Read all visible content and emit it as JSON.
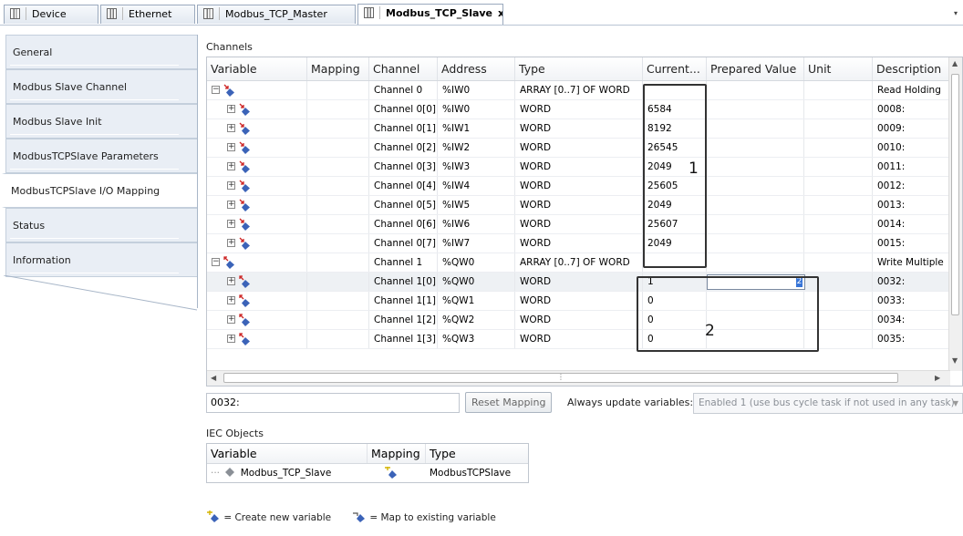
{
  "tabs": [
    {
      "label": "Device",
      "active": false
    },
    {
      "label": "Ethernet",
      "active": false
    },
    {
      "label": "Modbus_TCP_Master",
      "active": false
    },
    {
      "label": "Modbus_TCP_Slave",
      "active": true,
      "close": "x"
    }
  ],
  "sidebar": {
    "items": [
      {
        "label": "General"
      },
      {
        "label": "Modbus Slave Channel"
      },
      {
        "label": "Modbus Slave Init"
      },
      {
        "label": "ModbusTCPSlave Parameters"
      },
      {
        "label": "ModbusTCPSlave I/O Mapping",
        "selected": true
      },
      {
        "label": "Status"
      },
      {
        "label": "Information"
      }
    ]
  },
  "channels": {
    "group_label": "Channels",
    "columns": [
      "Variable",
      "Mapping",
      "Channel",
      "Address",
      "Type",
      "Current...",
      "Prepared Value",
      "Unit",
      "Description"
    ],
    "rows": [
      {
        "level": 0,
        "expander": "-",
        "dir": "in",
        "channel": "Channel 0",
        "address": "%IW0",
        "type": "ARRAY [0..7] OF WORD",
        "current": "",
        "prepared": "",
        "description": "Read Holding"
      },
      {
        "level": 1,
        "expander": "+",
        "dir": "in",
        "channel": "Channel 0[0]",
        "address": "%IW0",
        "type": "WORD",
        "current": "6584",
        "prepared": "",
        "description": "0008:"
      },
      {
        "level": 1,
        "expander": "+",
        "dir": "in",
        "channel": "Channel 0[1]",
        "address": "%IW1",
        "type": "WORD",
        "current": "8192",
        "prepared": "",
        "description": "0009:"
      },
      {
        "level": 1,
        "expander": "+",
        "dir": "in",
        "channel": "Channel 0[2]",
        "address": "%IW2",
        "type": "WORD",
        "current": "26545",
        "prepared": "",
        "description": "0010:"
      },
      {
        "level": 1,
        "expander": "+",
        "dir": "in",
        "channel": "Channel 0[3]",
        "address": "%IW3",
        "type": "WORD",
        "current": "2049",
        "prepared": "",
        "description": "0011:"
      },
      {
        "level": 1,
        "expander": "+",
        "dir": "in",
        "channel": "Channel 0[4]",
        "address": "%IW4",
        "type": "WORD",
        "current": "25605",
        "prepared": "",
        "description": "0012:"
      },
      {
        "level": 1,
        "expander": "+",
        "dir": "in",
        "channel": "Channel 0[5]",
        "address": "%IW5",
        "type": "WORD",
        "current": "2049",
        "prepared": "",
        "description": "0013:"
      },
      {
        "level": 1,
        "expander": "+",
        "dir": "in",
        "channel": "Channel 0[6]",
        "address": "%IW6",
        "type": "WORD",
        "current": "25607",
        "prepared": "",
        "description": "0014:"
      },
      {
        "level": 1,
        "expander": "+",
        "dir": "in",
        "channel": "Channel 0[7]",
        "address": "%IW7",
        "type": "WORD",
        "current": "2049",
        "prepared": "",
        "description": "0015:"
      },
      {
        "level": 0,
        "expander": "-",
        "dir": "out",
        "channel": "Channel 1",
        "address": "%QW0",
        "type": "ARRAY [0..7] OF WORD",
        "current": "",
        "prepared": "",
        "description": "Write Multiple"
      },
      {
        "level": 1,
        "expander": "+",
        "dir": "out",
        "channel": "Channel 1[0]",
        "address": "%QW0",
        "type": "WORD",
        "current": "1",
        "prepared": "2",
        "editing": true,
        "highlight": true,
        "description": "0032:"
      },
      {
        "level": 1,
        "expander": "+",
        "dir": "out",
        "channel": "Channel 1[1]",
        "address": "%QW1",
        "type": "WORD",
        "current": "0",
        "prepared": "",
        "description": "0033:"
      },
      {
        "level": 1,
        "expander": "+",
        "dir": "out",
        "channel": "Channel 1[2]",
        "address": "%QW2",
        "type": "WORD",
        "current": "0",
        "prepared": "",
        "description": "0034:"
      },
      {
        "level": 1,
        "expander": "+",
        "dir": "out",
        "channel": "Channel 1[3]",
        "address": "%QW3",
        "type": "WORD",
        "current": "0",
        "prepared": "",
        "description": "0035:"
      }
    ],
    "annotations": [
      "1",
      "2"
    ]
  },
  "footer": {
    "address_value": "0032:",
    "reset_label": "Reset Mapping",
    "always_label": "Always update variables:",
    "always_value": "Enabled 1 (use bus cycle task if not used in any task)"
  },
  "iec": {
    "group_label": "IEC Objects",
    "columns": [
      "Variable",
      "Mapping",
      "Type"
    ],
    "row": {
      "variable": "Modbus_TCP_Slave",
      "type": "ModbusTCPSlave"
    }
  },
  "legend": {
    "create": "= Create new variable",
    "map": "= Map to existing variable"
  },
  "colors": {
    "in_arrow": "#cc2222",
    "var_blue": "#3b63b8",
    "accent_select": "#3875d7"
  }
}
